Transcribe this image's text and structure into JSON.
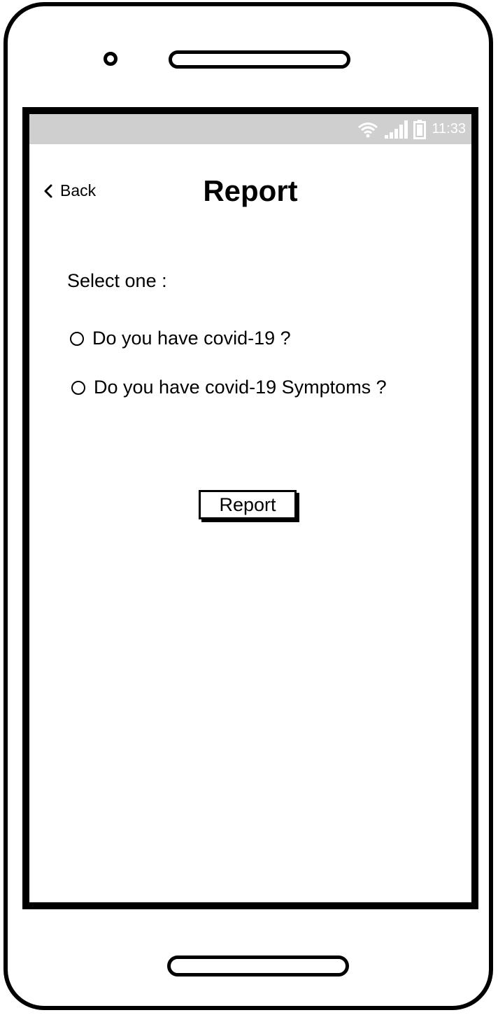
{
  "status_bar": {
    "time": "11:33",
    "icons": [
      "wifi-icon",
      "signal-icon",
      "battery-icon"
    ]
  },
  "header": {
    "back_label": "Back",
    "title": "Report"
  },
  "form": {
    "prompt": "Select one :",
    "options": [
      {
        "label": "Do you have covid-19 ?",
        "selected": false
      },
      {
        "label": "Do you have covid-19 Symptoms ?",
        "selected": false
      }
    ],
    "submit_label": "Report"
  },
  "colors": {
    "status_bar_bg": "#cfcfcf",
    "frame": "#000000",
    "background": "#ffffff"
  }
}
